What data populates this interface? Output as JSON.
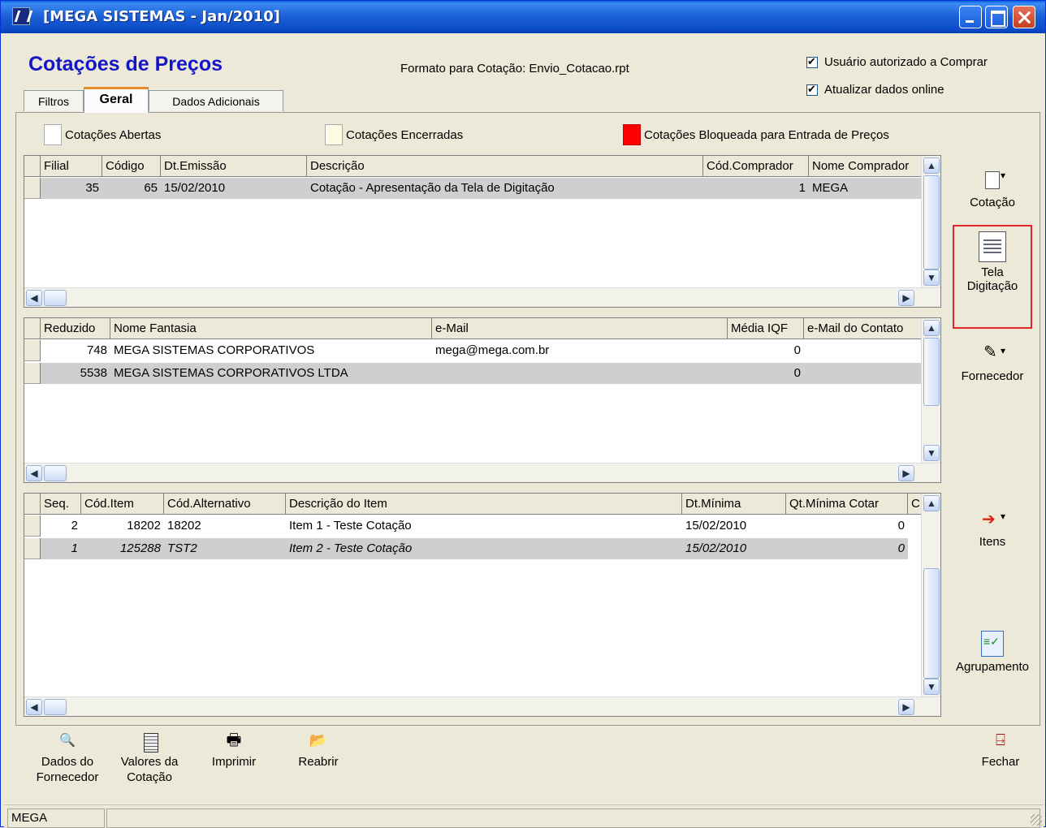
{
  "window": {
    "title": "[MEGA SISTEMAS - Jan/2010]"
  },
  "header": {
    "title": "Cotações de Preços",
    "format_label": "Formato para Cotação: Envio_Cotacao.rpt",
    "checkbox_authorized": "Usuário autorizado a Comprar",
    "checkbox_online": "Atualizar dados online"
  },
  "tabs": [
    "Filtros",
    "Geral",
    "Dados Adicionais"
  ],
  "legend": {
    "open": "Cotações Abertas",
    "closed": "Cotações Encerradas",
    "blocked": "Cotações Bloqueada para Entrada de Preços",
    "colors": {
      "open": "#ffffff",
      "closed": "#fdf9e2",
      "blocked": "#ff0000"
    }
  },
  "grid_cotacoes": {
    "headers": [
      "Filial",
      "Código",
      "Dt.Emissão",
      "Descrição",
      "Cód.Comprador",
      "Nome Comprador"
    ],
    "rows": [
      [
        "35",
        "65",
        "15/02/2010",
        "Cotação - Apresentação da Tela de Digitação",
        "1",
        "MEGA"
      ]
    ]
  },
  "grid_fornecedores": {
    "headers": [
      "Reduzido",
      "Nome Fantasia",
      "e-Mail",
      "Média IQF",
      "e-Mail do Contato"
    ],
    "rows": [
      [
        "748",
        "MEGA SISTEMAS CORPORATIVOS",
        "mega@mega.com.br",
        "0",
        ""
      ],
      [
        "5538",
        "MEGA SISTEMAS CORPORATIVOS LTDA",
        "",
        "0",
        ""
      ]
    ]
  },
  "grid_itens": {
    "headers": [
      "Seq.",
      "Cód.Item",
      "Cód.Alternativo",
      "Descrição do Item",
      "Dt.Mínima",
      "Qt.Mínima Cotar",
      "C"
    ],
    "rows": [
      [
        "2",
        "18202",
        "18202",
        "Item 1 - Teste Cotação",
        "15/02/2010",
        "0"
      ],
      [
        "1",
        "125288",
        "TST2",
        "Item 2 - Teste Cotação",
        "15/02/2010",
        "0"
      ]
    ]
  },
  "right_toolbar": {
    "cotacao": "Cotação",
    "tela_line1": "Tela",
    "tela_line2": "Digitação",
    "fornecedor": "Fornecedor",
    "itens": "Itens",
    "agrupamento": "Agrupamento"
  },
  "bottom_toolbar": {
    "dados_line1": "Dados do",
    "dados_line2": "Fornecedor",
    "valores_line1": "Valores da",
    "valores_line2": "Cotação",
    "imprimir": "Imprimir",
    "reabrir": "Reabrir",
    "fechar": "Fechar"
  },
  "status": {
    "user": "MEGA"
  }
}
